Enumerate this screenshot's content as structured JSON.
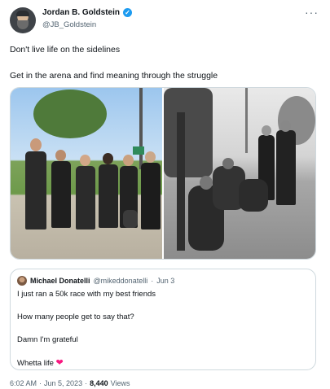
{
  "author": {
    "display_name": "Jordan B. Goldstein",
    "handle": "@JB_Goldstein",
    "verified_icon": "✓"
  },
  "more_icon": "···",
  "tweet_text": {
    "line1": "Don't live life on the sidelines",
    "line2": "Get in the arena and find meaning through the struggle"
  },
  "media": [
    {
      "name": "group-photo-standing"
    },
    {
      "name": "group-photo-sitting"
    }
  ],
  "quoted_tweet": {
    "display_name": "Michael Donatelli",
    "handle": "@mikeddonatelli",
    "separator": "·",
    "date": "Jun 3",
    "lines": [
      "I just ran a 50k race with my best friends",
      "How many people get to say that?",
      "Damn I'm grateful",
      "Whetta life"
    ],
    "heart": "❤",
    "heart_color": "#f91880"
  },
  "meta": {
    "time": "6:02 AM",
    "separator": "·",
    "date": "Jun 5, 2023",
    "separator2": "·",
    "views_count": "8,440",
    "views_label": "Views"
  },
  "colors": {
    "text_primary": "#0f1419",
    "text_secondary": "#536471",
    "verified_blue": "#1d9bf0",
    "border": "#cfd9de"
  }
}
